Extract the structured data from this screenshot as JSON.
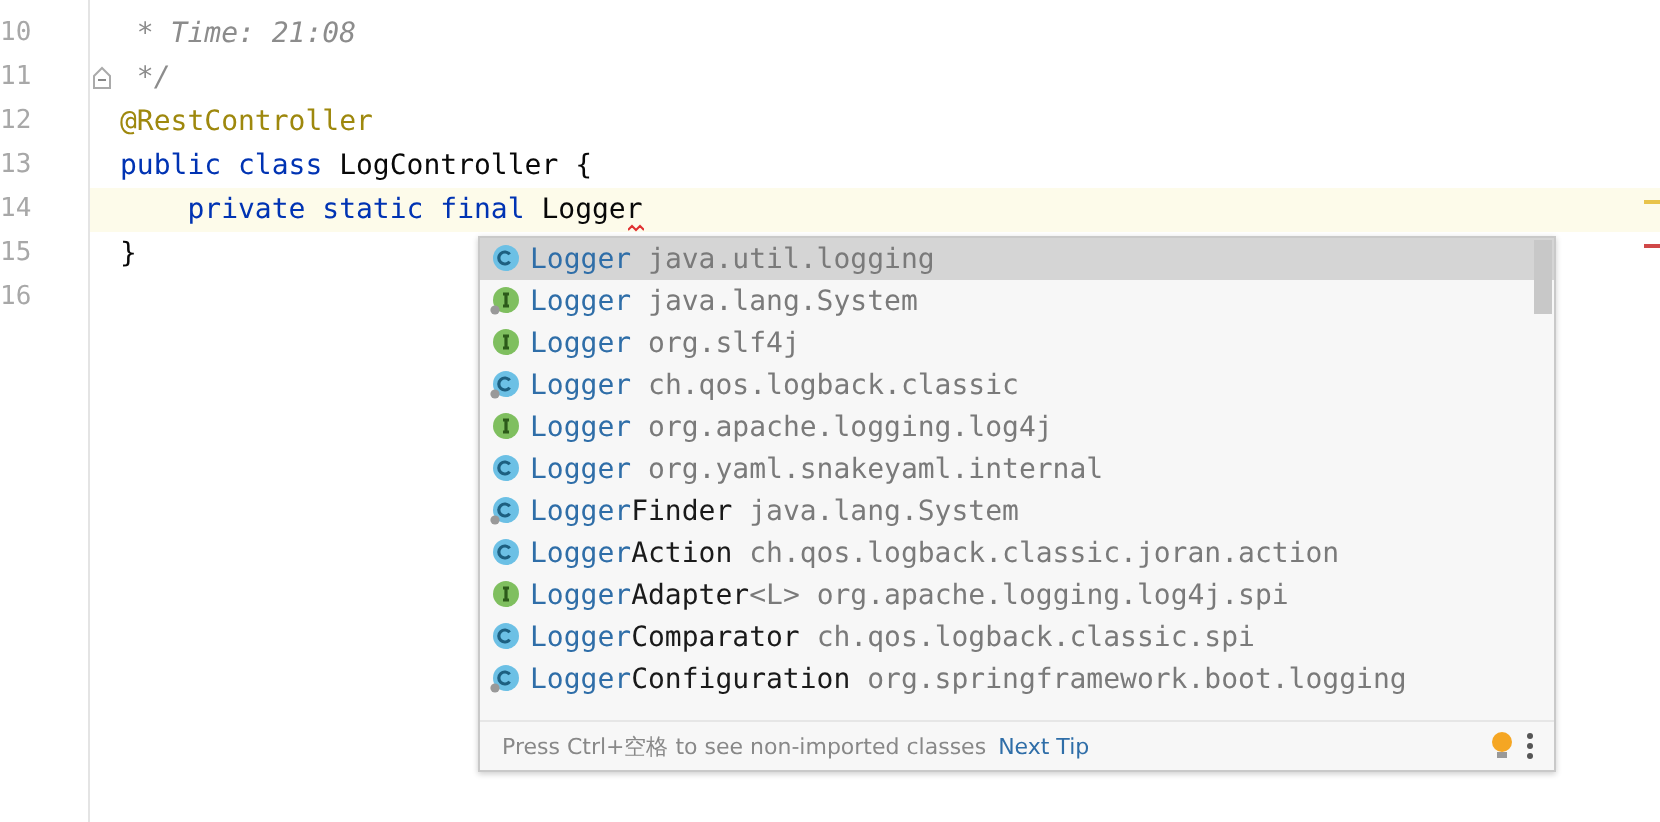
{
  "gutter": {
    "line_numbers": [
      "10",
      "11",
      "12",
      "13",
      "14",
      "15",
      "16"
    ]
  },
  "code": {
    "lines": [
      {
        "current": false,
        "fold": false,
        "segments": [
          {
            "kind": "comment",
            "text": " * Time: 21:08"
          }
        ]
      },
      {
        "current": false,
        "fold": true,
        "segments": [
          {
            "kind": "comment",
            "text": " */"
          }
        ]
      },
      {
        "current": false,
        "fold": false,
        "segments": [
          {
            "kind": "annotation",
            "text": "@RestController"
          }
        ]
      },
      {
        "current": false,
        "fold": false,
        "segments": [
          {
            "kind": "keyword",
            "text": "public class "
          },
          {
            "kind": "plain",
            "text": "LogController {"
          }
        ]
      },
      {
        "current": true,
        "fold": false,
        "segments": [
          {
            "kind": "keyword",
            "text": "    private static final "
          },
          {
            "kind": "plain",
            "text": "Logger"
          }
        ]
      },
      {
        "current": false,
        "fold": false,
        "segments": [
          {
            "kind": "plain",
            "text": "}"
          }
        ]
      },
      {
        "current": false,
        "fold": false
      }
    ]
  },
  "completion": {
    "items": [
      {
        "kind": "class",
        "decorated": false,
        "selected": true,
        "match": "Logger",
        "package": "java.util.logging"
      },
      {
        "kind": "interface",
        "decorated": true,
        "selected": false,
        "match": "Logger",
        "package": "java.lang.System"
      },
      {
        "kind": "interface",
        "decorated": false,
        "selected": false,
        "match": "Logger",
        "package": "org.slf4j"
      },
      {
        "kind": "class",
        "decorated": true,
        "selected": false,
        "match": "Logger",
        "package": "ch.qos.logback.classic"
      },
      {
        "kind": "interface",
        "decorated": false,
        "selected": false,
        "match": "Logger",
        "package": "org.apache.logging.log4j"
      },
      {
        "kind": "class",
        "decorated": false,
        "selected": false,
        "match": "Logger",
        "package": "org.yaml.snakeyaml.internal"
      },
      {
        "kind": "class",
        "decorated": true,
        "selected": false,
        "match": "Logger",
        "rest": "Finder",
        "package": "java.lang.System"
      },
      {
        "kind": "class",
        "decorated": false,
        "selected": false,
        "match": "Logger",
        "rest": "Action",
        "package": "ch.qos.logback.classic.joran.action"
      },
      {
        "kind": "interface",
        "decorated": false,
        "selected": false,
        "match": "Logger",
        "rest": "Adapter",
        "type_params": "<L>",
        "package": "org.apache.logging.log4j.spi"
      },
      {
        "kind": "class",
        "decorated": false,
        "selected": false,
        "match": "Logger",
        "rest": "Comparator",
        "package": "ch.qos.logback.classic.spi"
      },
      {
        "kind": "class",
        "decorated": true,
        "selected": false,
        "match": "Logger",
        "rest": "Configuration",
        "package": "org.springframework.boot.logging"
      }
    ],
    "hint": "Press Ctrl+空格 to see non-imported classes",
    "next_tip": "Next Tip"
  }
}
